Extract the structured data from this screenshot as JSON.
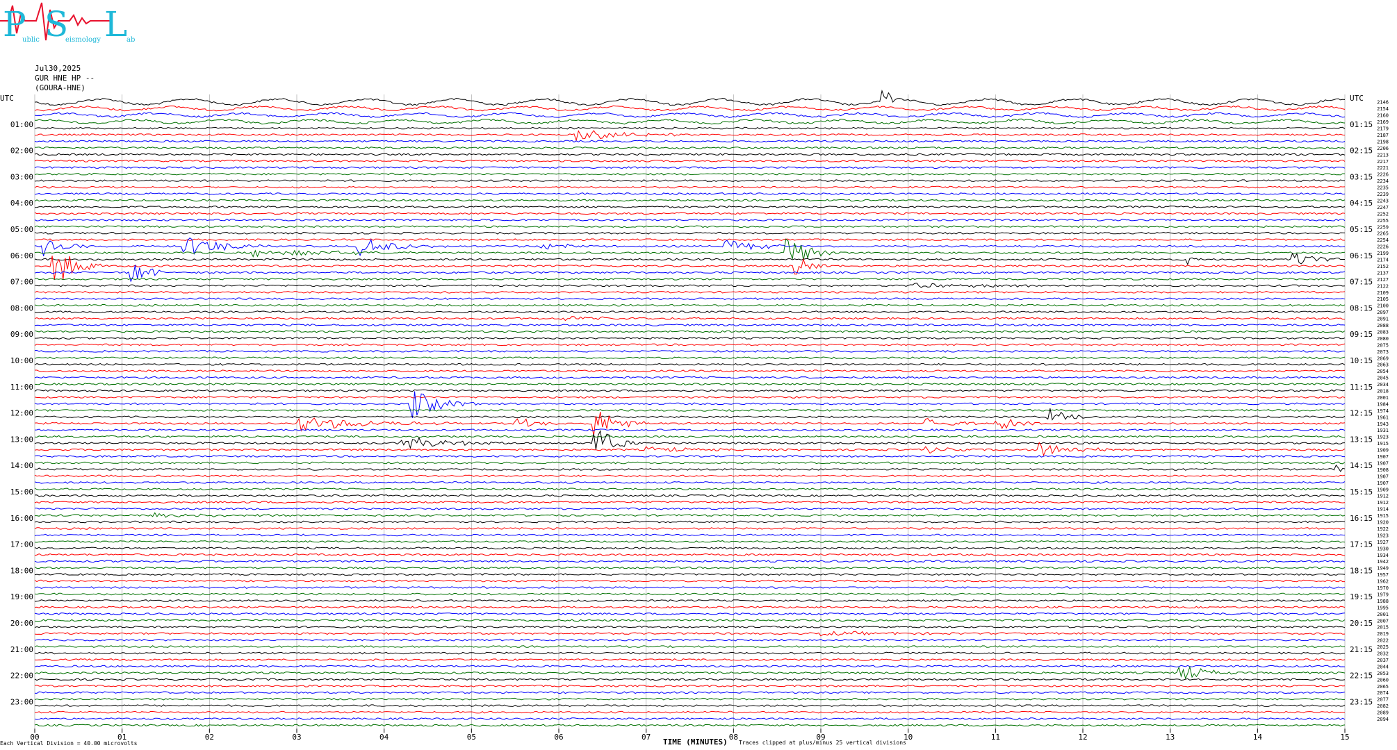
{
  "header": {
    "logo_letters": {
      "p": "P",
      "s": "S",
      "l": "L"
    },
    "logo_words": {
      "p": "ublic",
      "s": "eismology",
      "l": "ab"
    },
    "date": "Jul30,2025",
    "station": "GUR HNE HP --",
    "site": "(GOURA-HNE)"
  },
  "footer": {
    "scale": "Each Vertical Division =   40.00 microvolts",
    "xlabel": "TIME (MINUTES)",
    "clip_note": "Traces clipped at plus/minus 25 vertical divisions"
  },
  "colors": {
    "trace_cycle": [
      "#000000",
      "#ff0000",
      "#0000ff",
      "#007000"
    ],
    "logo": "#1fb8d8",
    "logo_wave": "#e8112d"
  },
  "chart_data": {
    "type": "line",
    "title": "",
    "xlabel": "TIME (MINUTES)",
    "xlim": [
      0,
      15
    ],
    "x_ticks": [
      "00",
      "01",
      "02",
      "03",
      "04",
      "05",
      "06",
      "07",
      "08",
      "09",
      "10",
      "11",
      "12",
      "13",
      "14",
      "15"
    ],
    "left_axis_label": "UTC",
    "right_axis_label": "UTC",
    "left_hour_labels": [
      "01:00",
      "02:00",
      "03:00",
      "04:00",
      "05:00",
      "06:00",
      "07:00",
      "08:00",
      "09:00",
      "10:00",
      "11:00",
      "12:00",
      "13:00",
      "14:00",
      "15:00",
      "16:00",
      "17:00",
      "18:00",
      "19:00",
      "20:00",
      "21:00",
      "22:00",
      "23:00"
    ],
    "right_hour_labels": [
      "01:15",
      "02:15",
      "03:15",
      "04:15",
      "05:15",
      "06:15",
      "07:15",
      "08:15",
      "09:15",
      "10:15",
      "11:15",
      "12:15",
      "13:15",
      "14:15",
      "15:15",
      "16:15",
      "17:15",
      "18:15",
      "19:15",
      "20:15",
      "21:15",
      "22:15",
      "23:15"
    ],
    "trace_count": 96,
    "trace_minutes": 15,
    "vertical_division_microvolts": 40.0,
    "clip_divisions": 25,
    "row_values": [
      2146,
      2154,
      2160,
      2169,
      2179,
      2187,
      2198,
      2206,
      2213,
      2217,
      2221,
      2226,
      2234,
      2235,
      2239,
      2243,
      2247,
      2252,
      2255,
      2259,
      2265,
      2254,
      2226,
      2199,
      2174,
      2152,
      2137,
      2127,
      2122,
      2109,
      2105,
      2100,
      2097,
      2091,
      2088,
      2083,
      2080,
      2075,
      2073,
      2069,
      2063,
      2054,
      2045,
      2034,
      2018,
      2001,
      1984,
      1974,
      1961,
      1943,
      1931,
      1923,
      1915,
      1909,
      1907,
      1907,
      1908,
      1907,
      1907,
      1909,
      1912,
      1912,
      1914,
      1915,
      1920,
      1922,
      1923,
      1927,
      1930,
      1934,
      1942,
      1949,
      1957,
      1962,
      1970,
      1979,
      1988,
      1995,
      2001,
      2007,
      2015,
      2019,
      2022,
      2025,
      2032,
      2037,
      2044,
      2053,
      2060,
      2065,
      2074,
      2077,
      2082,
      2089,
      2094
    ],
    "events": [
      {
        "row": 0,
        "minute": 9.7,
        "amp": 28,
        "dur": 0.15,
        "color": "red"
      },
      {
        "row": 5,
        "minute": 6.2,
        "amp": 9,
        "dur": 1.2,
        "color": "blue"
      },
      {
        "row": 22,
        "minute": 0.1,
        "amp": 14,
        "dur": 0.5,
        "color": "blue"
      },
      {
        "row": 25,
        "minute": 0.2,
        "amp": 30,
        "dur": 0.6,
        "color": "blue"
      },
      {
        "row": 26,
        "minute": 1.1,
        "amp": 22,
        "dur": 0.4,
        "color": "red"
      },
      {
        "row": 22,
        "minute": 1.7,
        "amp": 16,
        "dur": 1.0,
        "color": "blue"
      },
      {
        "row": 22,
        "minute": 3.7,
        "amp": 14,
        "dur": 1.0,
        "color": "blue"
      },
      {
        "row": 22,
        "minute": 5.8,
        "amp": 6,
        "dur": 0.8,
        "color": "blue"
      },
      {
        "row": 22,
        "minute": 7.9,
        "amp": 10,
        "dur": 0.8,
        "color": "blue"
      },
      {
        "row": 23,
        "minute": 8.6,
        "amp": 26,
        "dur": 0.6,
        "color": "green"
      },
      {
        "row": 25,
        "minute": 8.7,
        "amp": 16,
        "dur": 0.4,
        "color": "blue"
      },
      {
        "row": 23,
        "minute": 2.5,
        "amp": 6,
        "dur": 2.0,
        "color": "green"
      },
      {
        "row": 24,
        "minute": 14.4,
        "amp": 12,
        "dur": 0.6,
        "color": "red"
      },
      {
        "row": 24,
        "minute": 13.2,
        "amp": 8,
        "dur": 0.3,
        "color": "red"
      },
      {
        "row": 46,
        "minute": 4.3,
        "amp": 22,
        "dur": 0.8,
        "color": "blue"
      },
      {
        "row": 49,
        "minute": 3.0,
        "amp": 12,
        "dur": 1.8,
        "color": "blue"
      },
      {
        "row": 49,
        "minute": 5.5,
        "amp": 10,
        "dur": 0.5,
        "color": "red"
      },
      {
        "row": 49,
        "minute": 6.4,
        "amp": 24,
        "dur": 0.6,
        "color": "red"
      },
      {
        "row": 52,
        "minute": 6.4,
        "amp": 28,
        "dur": 0.5,
        "color": "green"
      },
      {
        "row": 49,
        "minute": 10.2,
        "amp": 10,
        "dur": 0.6,
        "color": "red"
      },
      {
        "row": 49,
        "minute": 11.0,
        "amp": 9,
        "dur": 0.8,
        "color": "red"
      },
      {
        "row": 48,
        "minute": 11.6,
        "amp": 14,
        "dur": 0.5,
        "color": "green"
      },
      {
        "row": 53,
        "minute": 11.5,
        "amp": 12,
        "dur": 0.8,
        "color": "black"
      },
      {
        "row": 53,
        "minute": 7.0,
        "amp": 4,
        "dur": 1.2,
        "color": "black"
      },
      {
        "row": 53,
        "minute": 10.2,
        "amp": 6,
        "dur": 0.5,
        "color": "black"
      },
      {
        "row": 52,
        "minute": 4.2,
        "amp": 10,
        "dur": 1.2,
        "color": "blue"
      },
      {
        "row": 56,
        "minute": 0.0,
        "amp": 5,
        "dur": 0.2,
        "color": "blue"
      },
      {
        "row": 56,
        "minute": 14.9,
        "amp": 8,
        "dur": 0.1,
        "color": "red"
      },
      {
        "row": 63,
        "minute": 1.3,
        "amp": 4,
        "dur": 1.8,
        "color": "green"
      },
      {
        "row": 87,
        "minute": 13.1,
        "amp": 14,
        "dur": 0.6,
        "color": "blue"
      },
      {
        "row": 81,
        "minute": 9.0,
        "amp": 3,
        "dur": 2.0,
        "color": "red"
      },
      {
        "row": 33,
        "minute": 6.0,
        "amp": 4,
        "dur": 1.0,
        "color": "blue"
      },
      {
        "row": 28,
        "minute": 10.0,
        "amp": 3,
        "dur": 3.0,
        "color": "red"
      },
      {
        "row": 4,
        "minute": 12.5,
        "amp": 3,
        "dur": 0.2,
        "color": "red"
      }
    ]
  }
}
